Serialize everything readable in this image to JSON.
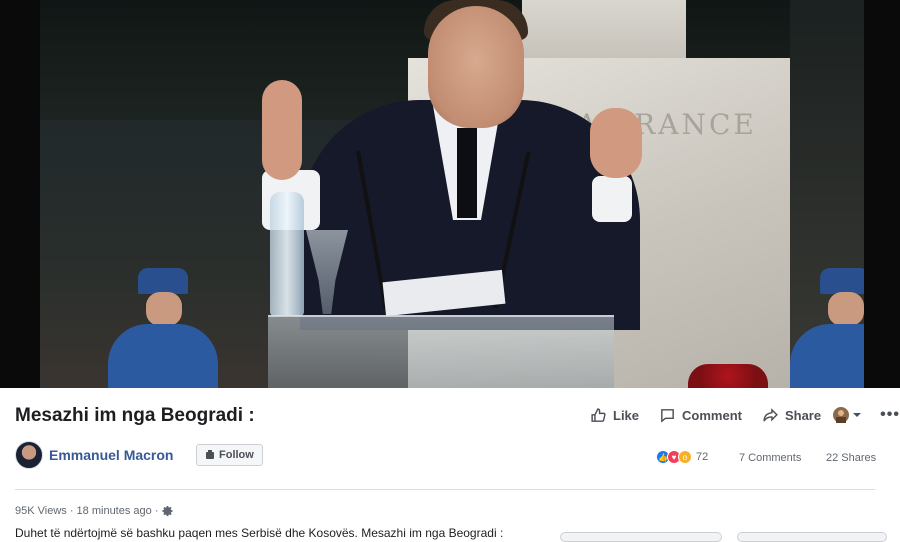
{
  "video": {
    "monument_text": "LA FRANCE"
  },
  "post": {
    "title": "Mesazhi im nga Beogradi :",
    "like_label": "Like",
    "comment_label": "Comment",
    "share_label": "Share",
    "more_label": "•••",
    "author_name": "Emmanuel Macron",
    "follow_label": "Follow",
    "reaction_count": "72",
    "comments_count": "7 Comments",
    "shares_count": "22 Shares",
    "views_time": "95K Views · 18 minutes ago ·",
    "description": "Duhet të ndërtojmë së bashku paqen mes Serbisë dhe Kosovës. Mesazhi im nga Beogradi :"
  },
  "colors": {
    "link_blue": "#385898",
    "like_blue": "#1877f2",
    "love_red": "#f33e58",
    "wow_yellow": "#f7b125"
  }
}
